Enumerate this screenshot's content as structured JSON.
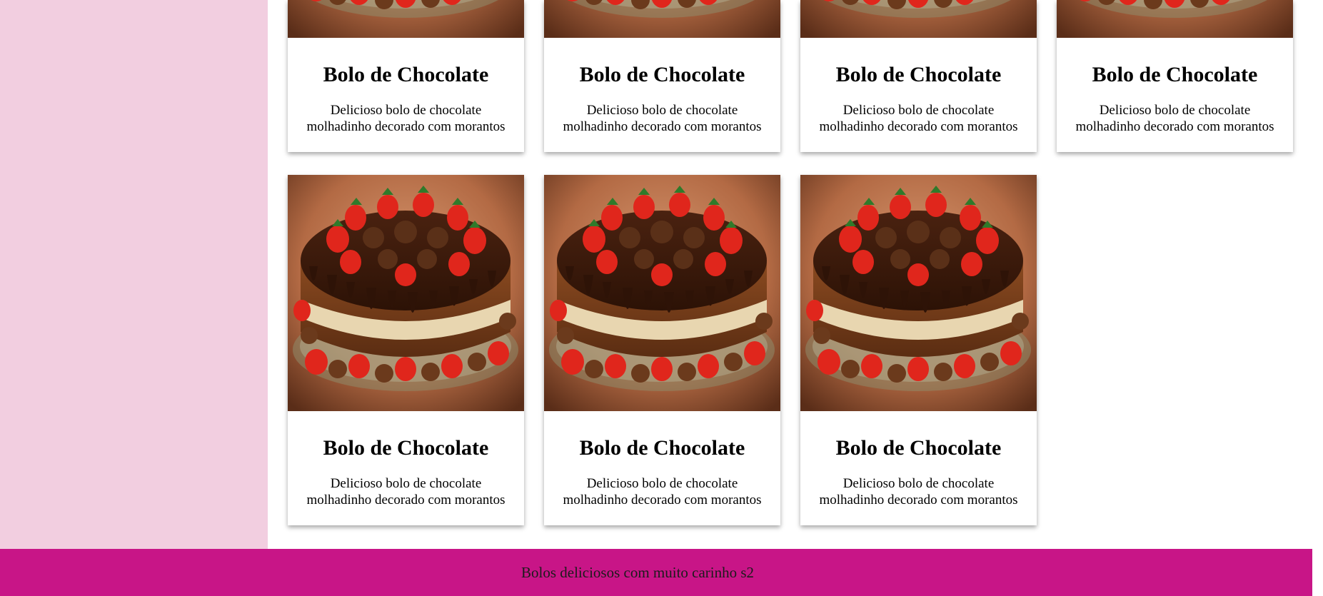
{
  "cards": [
    {
      "title": "Bolo de Chocolate",
      "desc_line1": "Delicioso bolo de chocolate",
      "desc_line2": "molhadinho decorado com morantos",
      "image": "chocolate-strawberry-cake"
    },
    {
      "title": "Bolo de Chocolate",
      "desc_line1": "Delicioso bolo de chocolate",
      "desc_line2": "molhadinho decorado com morantos",
      "image": "chocolate-strawberry-cake"
    },
    {
      "title": "Bolo de Chocolate",
      "desc_line1": "Delicioso bolo de chocolate",
      "desc_line2": "molhadinho decorado com morantos",
      "image": "chocolate-strawberry-cake"
    },
    {
      "title": "Bolo de Chocolate",
      "desc_line1": "Delicioso bolo de chocolate",
      "desc_line2": "molhadinho decorado com morantos",
      "image": "chocolate-strawberry-cake"
    },
    {
      "title": "Bolo de Chocolate",
      "desc_line1": "Delicioso bolo de chocolate",
      "desc_line2": "molhadinho decorado com morantos",
      "image": "chocolate-strawberry-cake"
    },
    {
      "title": "Bolo de Chocolate",
      "desc_line1": "Delicioso bolo de chocolate",
      "desc_line2": "molhadinho decorado com morantos",
      "image": "chocolate-strawberry-cake"
    },
    {
      "title": "Bolo de Chocolate",
      "desc_line1": "Delicioso bolo de chocolate",
      "desc_line2": "molhadinho decorado com morantos",
      "image": "chocolate-strawberry-cake"
    }
  ],
  "footer": {
    "text": "Bolos deliciosos com muito carinho s2"
  },
  "colors": {
    "sidebar": "#f2cee0",
    "footer": "#c81587",
    "card": "#ffffff"
  }
}
